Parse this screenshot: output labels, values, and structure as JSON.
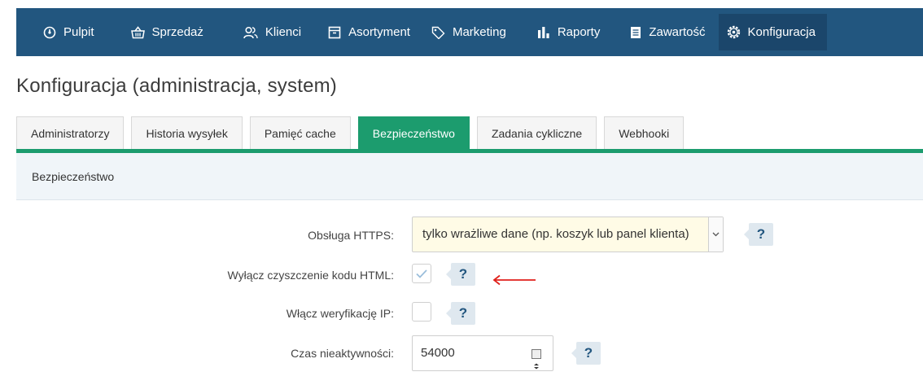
{
  "nav": {
    "items": [
      {
        "label": "Pulpit",
        "icon": "dashboard-icon"
      },
      {
        "label": "Sprzedaż",
        "icon": "basket-icon"
      },
      {
        "label": "Klienci",
        "icon": "users-icon"
      },
      {
        "label": "Asortyment",
        "icon": "box-icon"
      },
      {
        "label": "Marketing",
        "icon": "tag-icon"
      },
      {
        "label": "Raporty",
        "icon": "bar-chart-icon"
      },
      {
        "label": "Zawartość",
        "icon": "document-icon"
      },
      {
        "label": "Konfiguracja",
        "icon": "gear-icon"
      }
    ],
    "active_index": 7
  },
  "page": {
    "title": "Konfiguracja (administracja, system)"
  },
  "tabs": {
    "items": [
      "Administratorzy",
      "Historia wysyłek",
      "Pamięć cache",
      "Bezpieczeństwo",
      "Zadania cykliczne",
      "Webhooki"
    ],
    "active_index": 3
  },
  "section": {
    "title": "Bezpieczeństwo"
  },
  "form": {
    "https": {
      "label": "Obsługa HTTPS:",
      "value": "tylko wrażliwe dane (np. koszyk lub panel klienta)"
    },
    "html_cleanup": {
      "label": "Wyłącz czyszczenie kodu HTML:",
      "checked": true
    },
    "ip_verification": {
      "label": "Włącz weryfikację IP:",
      "checked": false
    },
    "inactivity": {
      "label": "Czas nieaktywności:",
      "value": "54000"
    },
    "help_text": "?"
  },
  "colors": {
    "navbar": "#22567f",
    "nav_active": "#1b466b",
    "tab_active": "#1c9c6e",
    "section_bg": "#f0f5f9",
    "select_bg": "#fffbe6",
    "annotation": "#e0201b"
  }
}
